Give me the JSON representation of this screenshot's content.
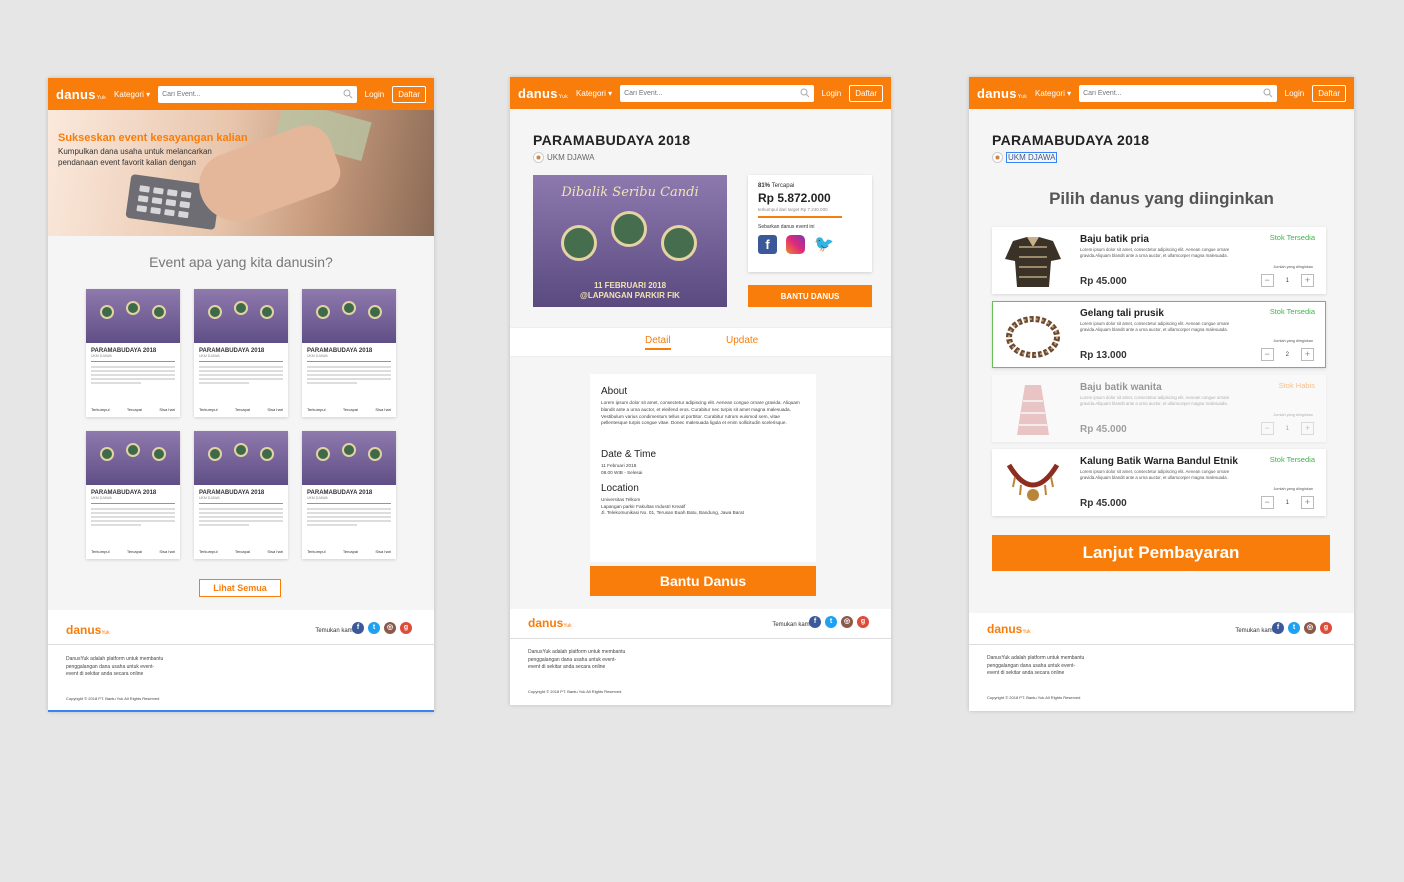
{
  "nav": {
    "logo": "danus",
    "logo_sub": "Yuk",
    "kategori": "Kategori",
    "search_placeholder": "Cari Event...",
    "login": "Login",
    "daftar": "Daftar"
  },
  "home": {
    "hero_title": "Sukseskan event kesayangan kalian",
    "hero_text": "Kumpulkan dana usaha untuk melancarkan pendanaan event favorit kalian dengan",
    "section_title": "Event apa yang kita danusin?",
    "cards": [
      {
        "title": "PARAMABUDAYA 2018",
        "org": "UKM DJAWA",
        "terkumpul": "Terkumpul",
        "tercapai": "Tercapai",
        "sisa": "Sisa hari"
      },
      {
        "title": "PARAMABUDAYA 2018",
        "org": "UKM DJAWA",
        "terkumpul": "Terkumpul",
        "tercapai": "Tercapai",
        "sisa": "Sisa hari"
      },
      {
        "title": "PARAMABUDAYA 2018",
        "org": "UKM DJAWA",
        "terkumpul": "Terkumpul",
        "tercapai": "Tercapai",
        "sisa": "Sisa hari"
      },
      {
        "title": "PARAMABUDAYA 2018",
        "org": "UKM DJAWA",
        "terkumpul": "Terkumpul",
        "tercapai": "Tercapai",
        "sisa": "Sisa hari"
      },
      {
        "title": "PARAMABUDAYA 2018",
        "org": "UKM DJAWA",
        "terkumpul": "Terkumpul",
        "tercapai": "Tercapai",
        "sisa": "Sisa hari"
      },
      {
        "title": "PARAMABUDAYA 2018",
        "org": "UKM DJAWA",
        "terkumpul": "Terkumpul",
        "tercapai": "Tercapai",
        "sisa": "Sisa hari"
      }
    ],
    "lihat_semua": "Lihat Semua"
  },
  "event": {
    "title": "PARAMABUDAYA 2018",
    "org": "UKM DJAWA",
    "poster_title": "Dibalik Seribu Candi",
    "poster_date": "11 FEBRUARI 2018",
    "poster_place": "@LAPANGAN PARKIR FIK",
    "percent": "81%",
    "percent_label": "Tercapai",
    "amount": "Rp 5.872.000",
    "target_label": "terkumpul dari target",
    "target": "Rp 7.240.000",
    "share_label": "Sebarkan danus event ini",
    "bantu_small": "BANTU DANUS",
    "tab_detail": "Detail",
    "tab_update": "Update",
    "about_h": "About",
    "about_text": "Lorem ipsum dolor sit amet, consectetur adipiscing elit. Aenean congue ornare gravida. Aliquam blandit ante a urna auctor, et eleifend eros. Curabitur nec turpis sit amet magna malesuada. Vestibulum varius condimentum tellus ut porttitor. Curabitur rutrum euismod sem, vitae pellentesque turpis congue vitae. Donec malesuada ligula et enim sollicitudin scelerisque.",
    "date_h": "Date & Time",
    "date_1": "11 Februari 2018",
    "date_2": "08.00 WIB - Selesai",
    "loc_h": "Location",
    "loc_1": "Universitas Telkom",
    "loc_2": "Lapangan parkir Fakultas Industri Kreatif",
    "loc_3": "Jl. Telekomunikasi No. 01, Terusan Buah Batu, Bandung, Jawa Barat",
    "bantu_big": "Bantu Danus"
  },
  "order": {
    "title": "PARAMABUDAYA 2018",
    "org": "UKM DJAWA",
    "pick_title": "Pilih danus yang diinginkan",
    "qty_label": "Jumlah yang diinginkan",
    "desc": "Lorem ipsum dolor sit amet, consectetur adipiscing elit. Aenean congue ornare gravida.Aliquam blandit ante a urna auctor, et ullamcorper magna malesuada.",
    "items": [
      {
        "name": "Baju batik pria",
        "stock": "Stok Tersedia",
        "price": "Rp 45.000",
        "qty": "1"
      },
      {
        "name": "Gelang tali prusik",
        "stock": "Stok Tersedia",
        "price": "Rp 13.000",
        "qty": "2"
      },
      {
        "name": "Baju batik wanita",
        "stock": "Stok Habis",
        "price": "Rp 45.000",
        "qty": "1"
      },
      {
        "name": "Kalung Batik Warna Bandul Etnik",
        "stock": "Stok Tersedia",
        "price": "Rp 45.000",
        "qty": "1"
      }
    ],
    "lanjut": "Lanjut Pembayaran"
  },
  "footer": {
    "logo": "danus",
    "find_us": "Temukan kami di:",
    "desc": "DanusYuk adalah platform untuk membantu penggalangan dana usaha untuk event-event di sekitar anda secara online",
    "copyright": "Copyright © 2018 PT. Bantu Yuk All Rights Reserved"
  },
  "colors": {
    "accent": "#f97d0b",
    "stock_ok": "#3cb54a"
  },
  "icons": [
    "search-icon",
    "chevron-down-icon",
    "facebook-icon",
    "twitter-icon",
    "instagram-icon",
    "google-plus-icon",
    "minus-icon",
    "plus-icon"
  ]
}
